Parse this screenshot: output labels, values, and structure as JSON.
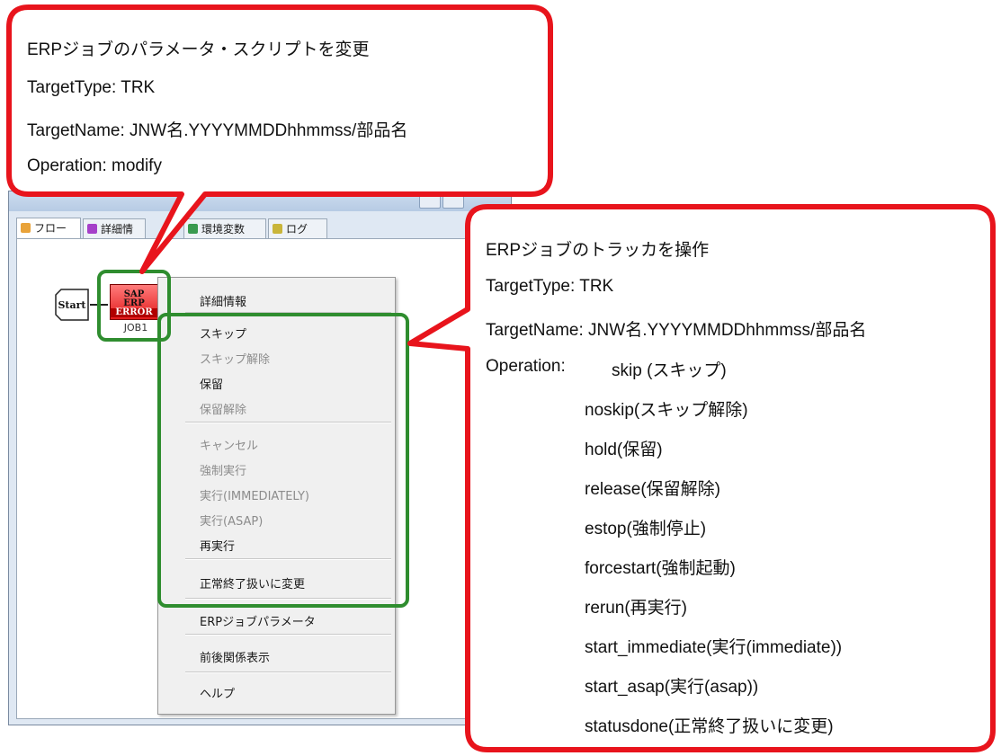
{
  "window": {
    "tabs": [
      {
        "label": "フロー",
        "icon": "flow-icon",
        "color": "#e9a33a"
      },
      {
        "label": "詳細情",
        "icon": "details-icon",
        "color": "#a640c9"
      },
      {
        "label": "環境変数",
        "icon": "env-icon",
        "color": "#3a9a4f"
      },
      {
        "label": "ログ",
        "icon": "log-icon",
        "color": "#c9b53a"
      }
    ]
  },
  "flow": {
    "start_label": "Start",
    "job_icon_lines": [
      "SAP",
      "ERP",
      "ERROR"
    ],
    "job_label": "JOB1"
  },
  "context_menu": {
    "items": [
      {
        "label": "詳細情報",
        "enabled": true
      },
      {
        "label": "スキップ",
        "enabled": true
      },
      {
        "label": "スキップ解除",
        "enabled": false
      },
      {
        "label": "保留",
        "enabled": true
      },
      {
        "label": "保留解除",
        "enabled": false
      },
      {
        "label": "キャンセル",
        "enabled": false
      },
      {
        "label": "強制実行",
        "enabled": false
      },
      {
        "label": "実行(IMMEDIATELY)",
        "enabled": false
      },
      {
        "label": "実行(ASAP)",
        "enabled": false
      },
      {
        "label": "再実行",
        "enabled": true
      },
      {
        "label": "正常終了扱いに変更",
        "enabled": true
      },
      {
        "label": "ERPジョブパラメータ",
        "enabled": true
      },
      {
        "label": "前後関係表示",
        "enabled": true
      },
      {
        "label": "ヘルプ",
        "enabled": true
      }
    ]
  },
  "callout_top": {
    "title": "ERPジョブのパラメータ・スクリプトを変更",
    "target_type": "TargetType: TRK",
    "target_name": "TargetName: JNW名.YYYYMMDDhhmmss/部品名",
    "operation": "Operation: modify"
  },
  "callout_right": {
    "title": "ERPジョブのトラッカを操作",
    "target_type": "TargetType: TRK",
    "target_name": "TargetName: JNW名.YYYYMMDDhhmmss/部品名",
    "operation_prefix": "Operation:",
    "operations": [
      "skip (スキップ)",
      "noskip(スキップ解除)",
      "hold(保留)",
      "release(保留解除)",
      "estop(強制停止)",
      "forcestart(強制起動)",
      "rerun(再実行)",
      "start_immediate(実行(immediate))",
      "start_asap(実行(asap))",
      "statusdone(正常終了扱いに変更)"
    ]
  },
  "colors": {
    "callout_border": "#e8141c",
    "highlight_border": "#2f8d2f"
  }
}
